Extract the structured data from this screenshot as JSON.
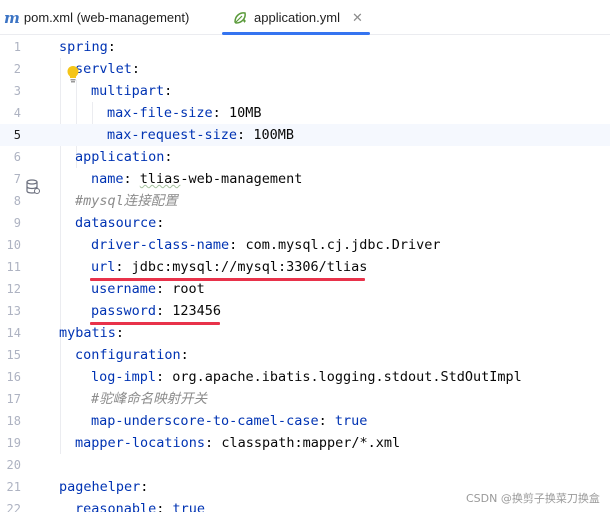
{
  "tabs": [
    {
      "label": "pom.xml (web-management)",
      "icon": "maven-m-icon",
      "active": false
    },
    {
      "label": "application.yml",
      "icon": "spring-leaf-icon",
      "active": true,
      "close": "✕"
    }
  ],
  "colors": {
    "accent": "#3574f0",
    "key": "#0033b3",
    "comment": "#8c8c8c",
    "annotation": "#e8324a"
  },
  "lines": [
    {
      "n": "1",
      "tokens": [
        {
          "t": "key",
          "v": "spring"
        },
        {
          "t": "punc",
          "v": ":"
        }
      ]
    },
    {
      "n": "2",
      "tokens": [
        {
          "t": "key",
          "v": "servlet"
        },
        {
          "t": "punc",
          "v": ":"
        }
      ]
    },
    {
      "n": "3",
      "tokens": [
        {
          "t": "key",
          "v": "multipart"
        },
        {
          "t": "punc",
          "v": ":"
        }
      ]
    },
    {
      "n": "4",
      "tokens": [
        {
          "t": "key",
          "v": "max-file-size"
        },
        {
          "t": "punc",
          "v": ": "
        },
        {
          "t": "val",
          "v": "10MB"
        }
      ]
    },
    {
      "n": "5",
      "tokens": [
        {
          "t": "key",
          "v": "max-request-size"
        },
        {
          "t": "punc",
          "v": ": "
        },
        {
          "t": "val",
          "v": "100MB"
        }
      ]
    },
    {
      "n": "6",
      "tokens": [
        {
          "t": "key",
          "v": "application"
        },
        {
          "t": "punc",
          "v": ":"
        }
      ]
    },
    {
      "n": "7",
      "tokens": [
        {
          "t": "key",
          "v": "name"
        },
        {
          "t": "punc",
          "v": ": "
        },
        {
          "t": "val typo",
          "v": "tlias"
        },
        {
          "t": "val",
          "v": "-web-management"
        }
      ]
    },
    {
      "n": "8",
      "tokens": [
        {
          "t": "comment",
          "v": "#mysql连接配置"
        }
      ]
    },
    {
      "n": "9",
      "tokens": [
        {
          "t": "key",
          "v": "datasource"
        },
        {
          "t": "punc",
          "v": ":"
        }
      ]
    },
    {
      "n": "10",
      "tokens": [
        {
          "t": "key",
          "v": "driver-class-name"
        },
        {
          "t": "punc",
          "v": ": "
        },
        {
          "t": "val",
          "v": "com.mysql.cj.jdbc.Driver"
        }
      ]
    },
    {
      "n": "11",
      "tokens": [
        {
          "t": "key",
          "v": "url"
        },
        {
          "t": "punc",
          "v": ": "
        },
        {
          "t": "val",
          "v": "jdbc:mysql://mysql:3306/tlias"
        }
      ]
    },
    {
      "n": "12",
      "tokens": [
        {
          "t": "key",
          "v": "username"
        },
        {
          "t": "punc",
          "v": ": "
        },
        {
          "t": "val",
          "v": "root"
        }
      ]
    },
    {
      "n": "13",
      "tokens": [
        {
          "t": "key",
          "v": "password"
        },
        {
          "t": "punc",
          "v": ": "
        },
        {
          "t": "val",
          "v": "123456"
        }
      ]
    },
    {
      "n": "14",
      "tokens": [
        {
          "t": "key",
          "v": "mybatis"
        },
        {
          "t": "punc",
          "v": ":"
        }
      ]
    },
    {
      "n": "15",
      "tokens": [
        {
          "t": "key",
          "v": "configuration"
        },
        {
          "t": "punc",
          "v": ":"
        }
      ]
    },
    {
      "n": "16",
      "tokens": [
        {
          "t": "key",
          "v": "log-impl"
        },
        {
          "t": "punc",
          "v": ": "
        },
        {
          "t": "val",
          "v": "org.apache.ibatis.logging.stdout.StdOutImpl"
        }
      ]
    },
    {
      "n": "17",
      "tokens": [
        {
          "t": "comment",
          "v": "#驼峰命名映射开关"
        }
      ]
    },
    {
      "n": "18",
      "tokens": [
        {
          "t": "key",
          "v": "map-underscore-to-camel-case"
        },
        {
          "t": "punc",
          "v": ": "
        },
        {
          "t": "kw",
          "v": "true"
        }
      ]
    },
    {
      "n": "19",
      "tokens": [
        {
          "t": "key",
          "v": "mapper-locations"
        },
        {
          "t": "punc",
          "v": ": "
        },
        {
          "t": "val",
          "v": "classpath:mapper/*.xml"
        }
      ]
    },
    {
      "n": "20",
      "tokens": []
    },
    {
      "n": "21",
      "tokens": [
        {
          "t": "key",
          "v": "pagehelper"
        },
        {
          "t": "punc",
          "v": ":"
        }
      ]
    },
    {
      "n": "22",
      "tokens": [
        {
          "t": "key",
          "v": "reasonable"
        },
        {
          "t": "punc",
          "v": ": "
        },
        {
          "t": "kw",
          "v": "true"
        }
      ]
    }
  ],
  "watermark": "CSDN @换剪子换菜刀换盒"
}
